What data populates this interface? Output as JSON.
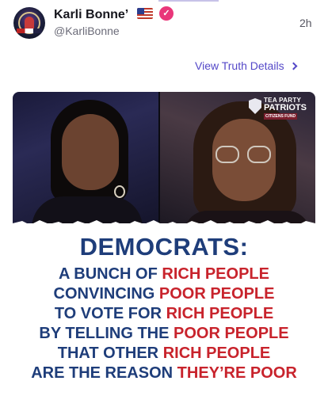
{
  "post": {
    "author_name": "Karli Bonne’",
    "flag_emoji": "flag-us-icon",
    "handle": "@KarliBonne",
    "time": "2h",
    "details_link": "View Truth Details"
  },
  "image": {
    "logo": {
      "line1": "TEA PARTY",
      "line2": "PATRIOTS",
      "line3": "CITIZENS FUND"
    },
    "headline": "DEMOCRATS:",
    "lines": [
      {
        "blue": "A BUNCH OF ",
        "red": "RICH PEOPLE"
      },
      {
        "blue": "CONVINCING ",
        "red": "POOR PEOPLE"
      },
      {
        "blue": "TO VOTE FOR ",
        "red": "RICH PEOPLE"
      },
      {
        "blue": "BY TELLING THE ",
        "red": "POOR PEOPLE"
      },
      {
        "blue": "THAT OTHER ",
        "red": "RICH PEOPLE"
      },
      {
        "blue": "ARE THE REASON ",
        "red": "THEY’RE POOR"
      }
    ]
  },
  "colors": {
    "headline_blue": "#1e3d7a",
    "accent_red": "#c8232c",
    "link_purple": "#5448c8",
    "verified_pink": "#e9367a"
  }
}
